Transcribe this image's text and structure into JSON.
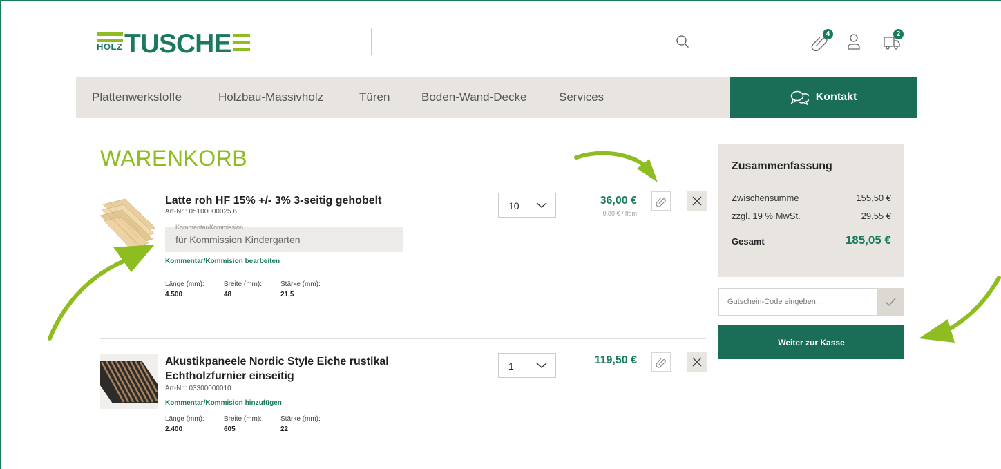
{
  "brand": {
    "holz": "HOLZ",
    "tusche": "TUSCHE",
    "accent": "#8dbd21",
    "primary": "#1a7a5e"
  },
  "header": {
    "search_placeholder": "",
    "notes_badge": "4",
    "cart_badge": "2",
    "icons": [
      "paperclip-icon",
      "user-icon",
      "delivery-truck-icon"
    ]
  },
  "nav": {
    "items": [
      "Plattenwerkstoffe",
      "Holzbau-Massivholz",
      "Türen",
      "Boden-Wand-Decke",
      "Services"
    ],
    "contact_label": "Kontakt"
  },
  "page": {
    "title": "WARENKORB"
  },
  "cart": {
    "items": [
      {
        "title": "Latte roh HF 15% +/- 3% 3-seitig gehobelt",
        "art_nr": "Art-Nr.: 05100000025.6",
        "comment_label": "Kommentar/Kommission",
        "comment_value": "für Kommission Kindergarten",
        "comment_link": "Kommentar/Kommision bearbeiten",
        "dims": [
          {
            "label": "Länge (mm):",
            "value": "4.500"
          },
          {
            "label": "Breite (mm):",
            "value": "48"
          },
          {
            "label": "Stärke (mm):",
            "value": "21,5"
          }
        ],
        "quantity": "10",
        "price": "36,00 €",
        "unit_price": "0,80 € / lfdm"
      },
      {
        "title": "Akustikpaneele Nordic Style Eiche rustikal Echtholzfurnier einseitig",
        "art_nr": "Art-Nr.: 03300000010",
        "comment_link": "Kommentar/Kommision hinzufügen",
        "dims": [
          {
            "label": "Länge (mm):",
            "value": "2.400"
          },
          {
            "label": "Breite (mm):",
            "value": "605"
          },
          {
            "label": "Stärke (mm):",
            "value": "22"
          }
        ],
        "quantity": "1",
        "price": "119,50 €"
      }
    ]
  },
  "summary": {
    "title": "Zusammenfassung",
    "subtotal_label": "Zwischensumme",
    "subtotal_value": "155,50 €",
    "tax_label": "zzgl. 19 % MwSt.",
    "tax_value": "29,55 €",
    "total_label": "Gesamt",
    "total_value": "185,05 €",
    "voucher_placeholder": "Gutschein-Code eingeben ...",
    "checkout_label": "Weiter zur Kasse"
  }
}
